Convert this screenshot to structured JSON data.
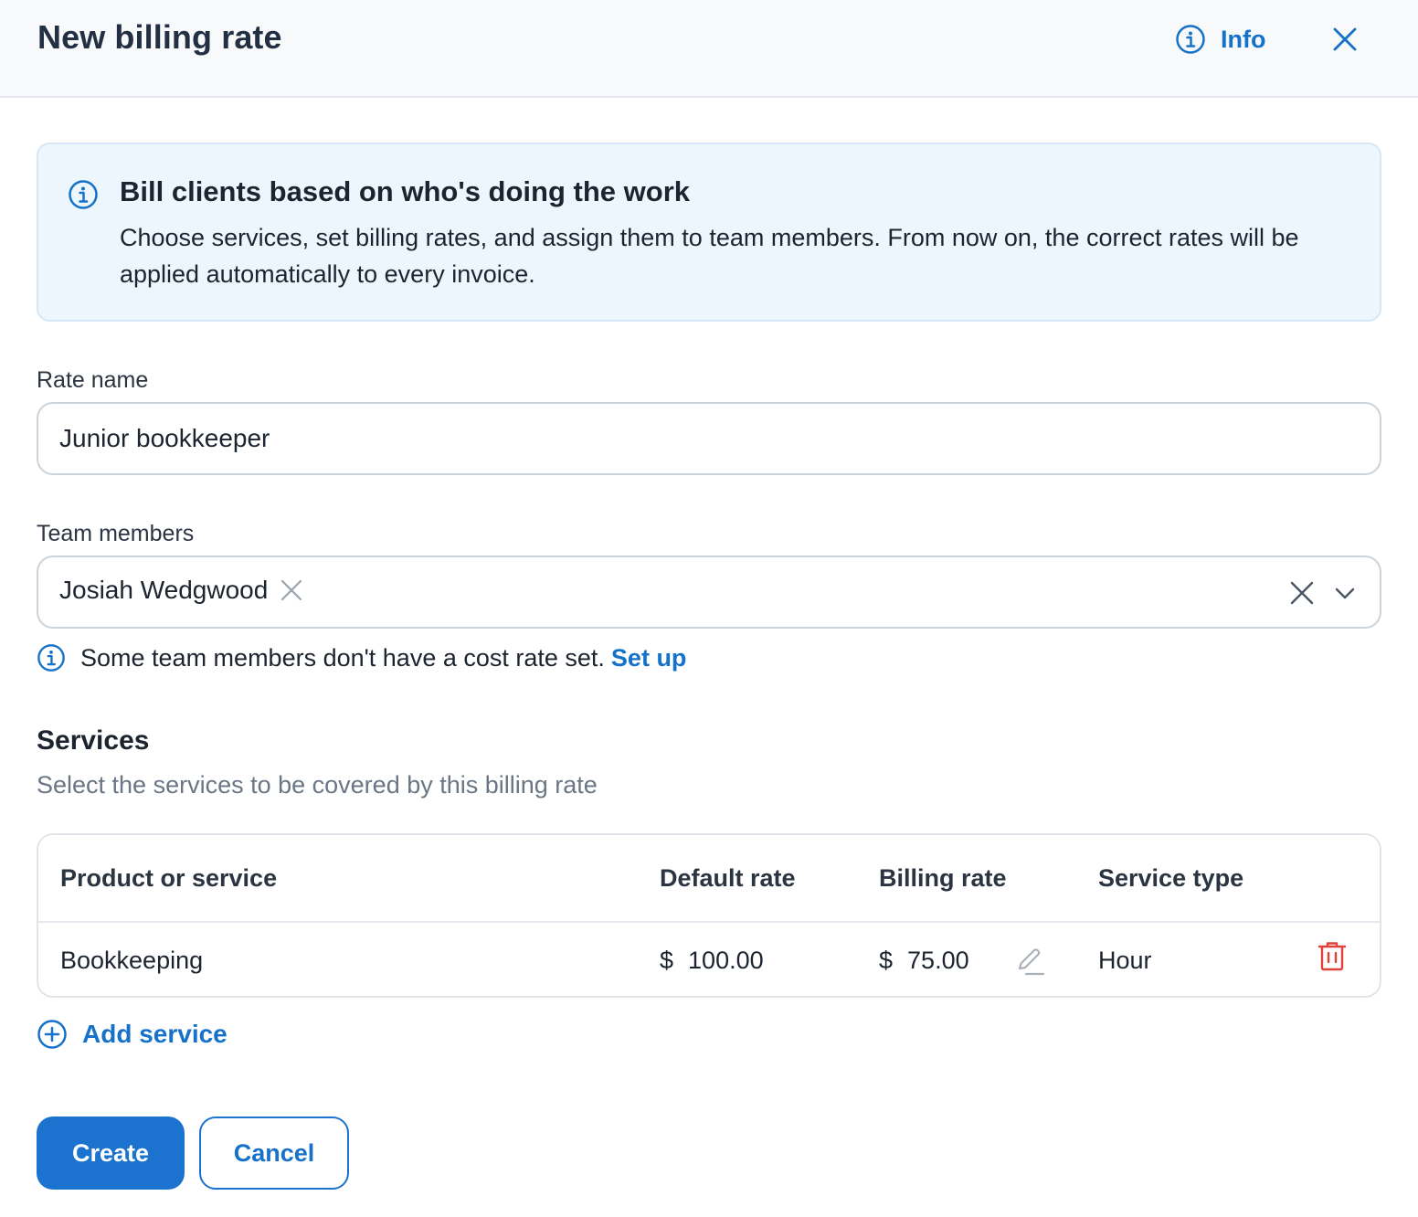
{
  "header": {
    "title": "New billing rate",
    "info_label": "Info",
    "info_icon": "info-circle-icon",
    "close_icon": "close-icon"
  },
  "banner": {
    "icon": "info-circle-icon",
    "title": "Bill clients based on who's doing the work",
    "text": "Choose services, set billing rates, and assign them to team members. From now on, the correct rates will be applied automatically to every invoice."
  },
  "rate_name": {
    "label": "Rate name",
    "value": "Junior bookkeeper"
  },
  "team_members": {
    "label": "Team members",
    "selected": [
      "Josiah Wedgwood"
    ],
    "notice": "Some team members don't have a cost rate set.",
    "notice_link": "Set up"
  },
  "services": {
    "title": "Services",
    "subtitle": "Select the services to be covered by this billing rate",
    "columns": [
      "Product or service",
      "Default rate",
      "Billing rate",
      "Service type"
    ],
    "rows": [
      {
        "name": "Bookkeeping",
        "default_currency": "$",
        "default_rate": "100.00",
        "billing_currency": "$",
        "billing_rate": "75.00",
        "service_type": "Hour"
      }
    ],
    "add_label": "Add service"
  },
  "actions": {
    "create": "Create",
    "cancel": "Cancel"
  },
  "colors": {
    "accent": "#1b72cf",
    "link": "#1672c9",
    "danger": "#e0413a",
    "banner_bg": "#eef6fd"
  }
}
